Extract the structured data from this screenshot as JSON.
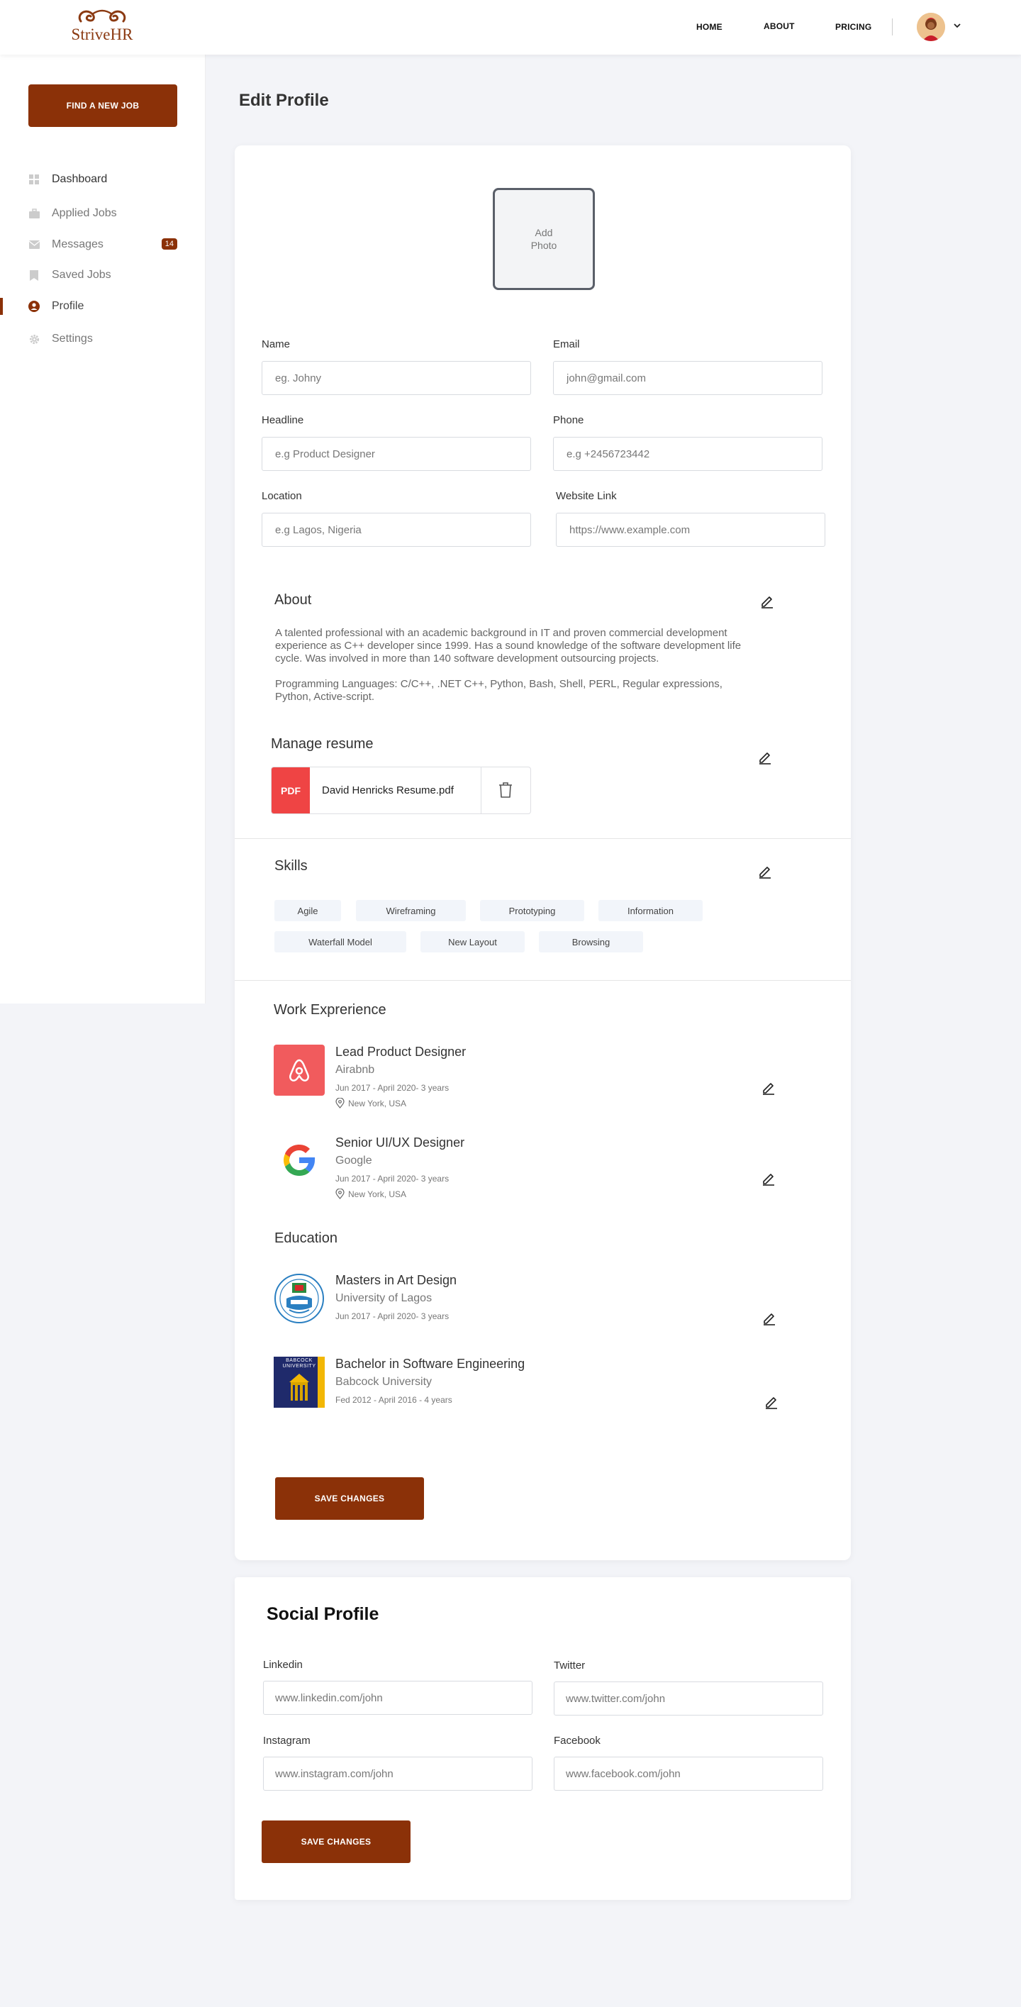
{
  "header": {
    "logo_text": "StriveHR",
    "logo_tagline": "",
    "nav": [
      "HOME",
      "ABOUT",
      "PRICING"
    ]
  },
  "sidebar": {
    "cta": "FIND A NEW JOB",
    "items": [
      {
        "label": "Dashboard",
        "icon": "grid-icon"
      },
      {
        "label": "Applied Jobs",
        "icon": "briefcase-icon"
      },
      {
        "label": "Messages",
        "icon": "mail-icon",
        "badge": "14"
      },
      {
        "label": "Saved Jobs",
        "icon": "bookmark-icon"
      },
      {
        "label": "Profile",
        "icon": "user-icon",
        "active": true
      },
      {
        "label": "Settings",
        "icon": "gear-icon"
      }
    ]
  },
  "page": {
    "title": "Edit Profile"
  },
  "profile": {
    "add_photo": "Add Photo",
    "fields": {
      "name": {
        "label": "Name",
        "placeholder": "eg. Johny"
      },
      "email": {
        "label": "Email",
        "placeholder": "john@gmail.com"
      },
      "headline": {
        "label": "Headline",
        "placeholder": "e.g Product Designer"
      },
      "phone": {
        "label": "Phone",
        "placeholder": "e.g +2456723442"
      },
      "location": {
        "label": "Location",
        "placeholder": "e.g Lagos, Nigeria"
      },
      "website": {
        "label": "Website Link",
        "placeholder": "https://www.example.com"
      }
    },
    "about": {
      "title": "About",
      "p1": "A talented professional with an academic background in IT and proven commercial development experience as C++ developer since 1999. Has a sound knowledge of the software development life cycle. Was involved in more than 140 software development outsourcing projects.",
      "p2": "Programming Languages: C/C++, .NET C++, Python, Bash, Shell, PERL, Regular expressions, Python, Active-script."
    },
    "resume": {
      "title": "Manage resume",
      "tag": "PDF",
      "file": "David Henricks Resume.pdf"
    },
    "skills": {
      "title": "Skills",
      "items": [
        "Agile",
        "Wireframing",
        "Prototyping",
        "Information",
        "Waterfall Model",
        "New Layout",
        "Browsing"
      ]
    },
    "work": {
      "title": "Work Exprerience",
      "items": [
        {
          "title": "Lead Product Designer",
          "company": "Airabnb",
          "date": "Jun 2017 - April 2020- 3 years",
          "location": "New York, USA"
        },
        {
          "title": "Senior UI/UX Designer",
          "company": "Google",
          "date": "Jun 2017 - April 2020- 3 years",
          "location": "New York, USA"
        }
      ]
    },
    "education": {
      "title": "Education",
      "items": [
        {
          "title": "Masters in Art Design",
          "school": "University of Lagos",
          "date": "Jun 2017 - April 2020- 3 years"
        },
        {
          "title": "Bachelor in Software Engineering",
          "school": "Babcock University",
          "date": "Fed 2012 - April 2016 - 4 years",
          "logo_text": "BABCOCK UNIVERSITY"
        }
      ]
    },
    "save": "SAVE CHANGES"
  },
  "social": {
    "title": "Social Profile",
    "fields": {
      "linkedin": {
        "label": "Linkedin",
        "placeholder": "www.linkedin.com/john"
      },
      "twitter": {
        "label": "Twitter",
        "placeholder": "www.twitter.com/john"
      },
      "instagram": {
        "label": "Instagram",
        "placeholder": "www.instagram.com/john"
      },
      "facebook": {
        "label": "Facebook",
        "placeholder": "www.facebook.com/john"
      }
    },
    "save": "SAVE CHANGES"
  },
  "colors": {
    "brand": "#8b3108",
    "pdf": "#ef4444",
    "airbnb": "#f15b5d"
  }
}
